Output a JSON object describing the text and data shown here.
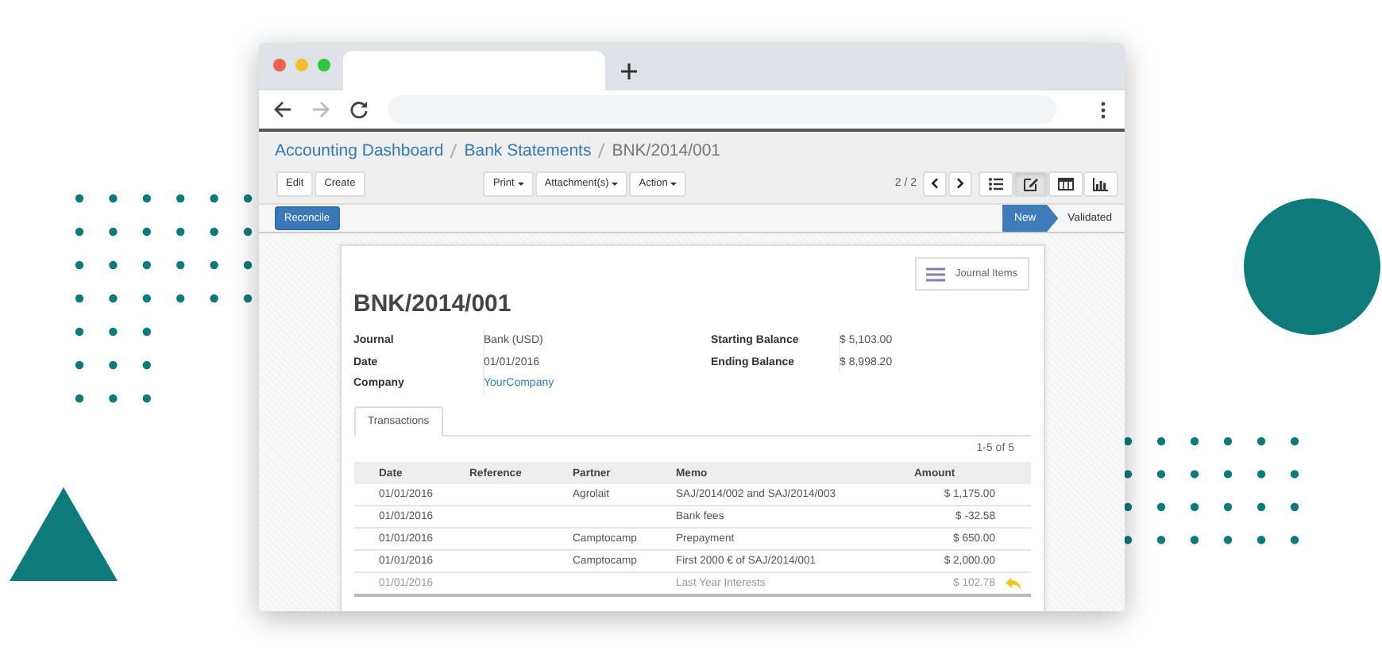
{
  "browser": {
    "back_enabled": true,
    "forward_enabled": false
  },
  "breadcrumbs": [
    {
      "label": "Accounting Dashboard",
      "current": false
    },
    {
      "label": "Bank Statements",
      "current": false
    },
    {
      "label": "BNK/2014/001",
      "current": true
    }
  ],
  "toolbar": {
    "buttons": [
      "Edit",
      "Create"
    ],
    "menus": [
      "Print",
      "Attachment(s)",
      "Action"
    ],
    "pager": "2 / 2",
    "views": [
      {
        "kind": "list",
        "selected": false
      },
      {
        "kind": "form",
        "selected": true
      },
      {
        "kind": "pivot",
        "selected": false
      },
      {
        "kind": "graph",
        "selected": false
      }
    ]
  },
  "statusbar": {
    "buttons": [
      "Reconcile"
    ],
    "stages": [
      {
        "label": "New",
        "selected": true
      },
      {
        "label": "Validated",
        "selected": false
      }
    ]
  },
  "sheet": {
    "smart_button": "Journal Items",
    "title": "BNK/2014/001",
    "fields_left": [
      {
        "label": "Journal",
        "value": "Bank (USD)",
        "kind": "text"
      },
      {
        "label": "Date",
        "value": "01/01/2016",
        "kind": "text"
      },
      {
        "label": "Company",
        "value": "YourCompany",
        "kind": "link"
      }
    ],
    "fields_right": [
      {
        "label": "Starting Balance",
        "value": "$ 5,103.00",
        "kind": "text"
      },
      {
        "label": "Ending Balance",
        "value": "$ 8,998.20",
        "kind": "text"
      }
    ],
    "tabs": [
      {
        "label": "Transactions",
        "selected": true
      }
    ],
    "table": {
      "pager": "1-5 of 5",
      "columns": [
        "Date",
        "Reference",
        "Partner",
        "Memo",
        "Amount"
      ],
      "rows": [
        {
          "cells": [
            "01/01/2016",
            "",
            "Agrolait",
            "SAJ/2014/002 and SAJ/2014/003",
            "$ 1,175.00"
          ],
          "muted": false,
          "revert_icon": false
        },
        {
          "cells": [
            "01/01/2016",
            "",
            "",
            "Bank fees",
            "$ -32.58"
          ],
          "muted": false,
          "revert_icon": false
        },
        {
          "cells": [
            "01/01/2016",
            "",
            "Camptocamp",
            "Prepayment",
            "$ 650.00"
          ],
          "muted": false,
          "revert_icon": false
        },
        {
          "cells": [
            "01/01/2016",
            "",
            "Camptocamp",
            "First 2000 € of SAJ/2014/001",
            "$ 2,000.00"
          ],
          "muted": false,
          "revert_icon": false
        },
        {
          "cells": [
            "01/01/2016",
            "",
            "",
            "Last Year Interests",
            "$ 102.78"
          ],
          "muted": true,
          "revert_icon": true
        }
      ]
    }
  }
}
